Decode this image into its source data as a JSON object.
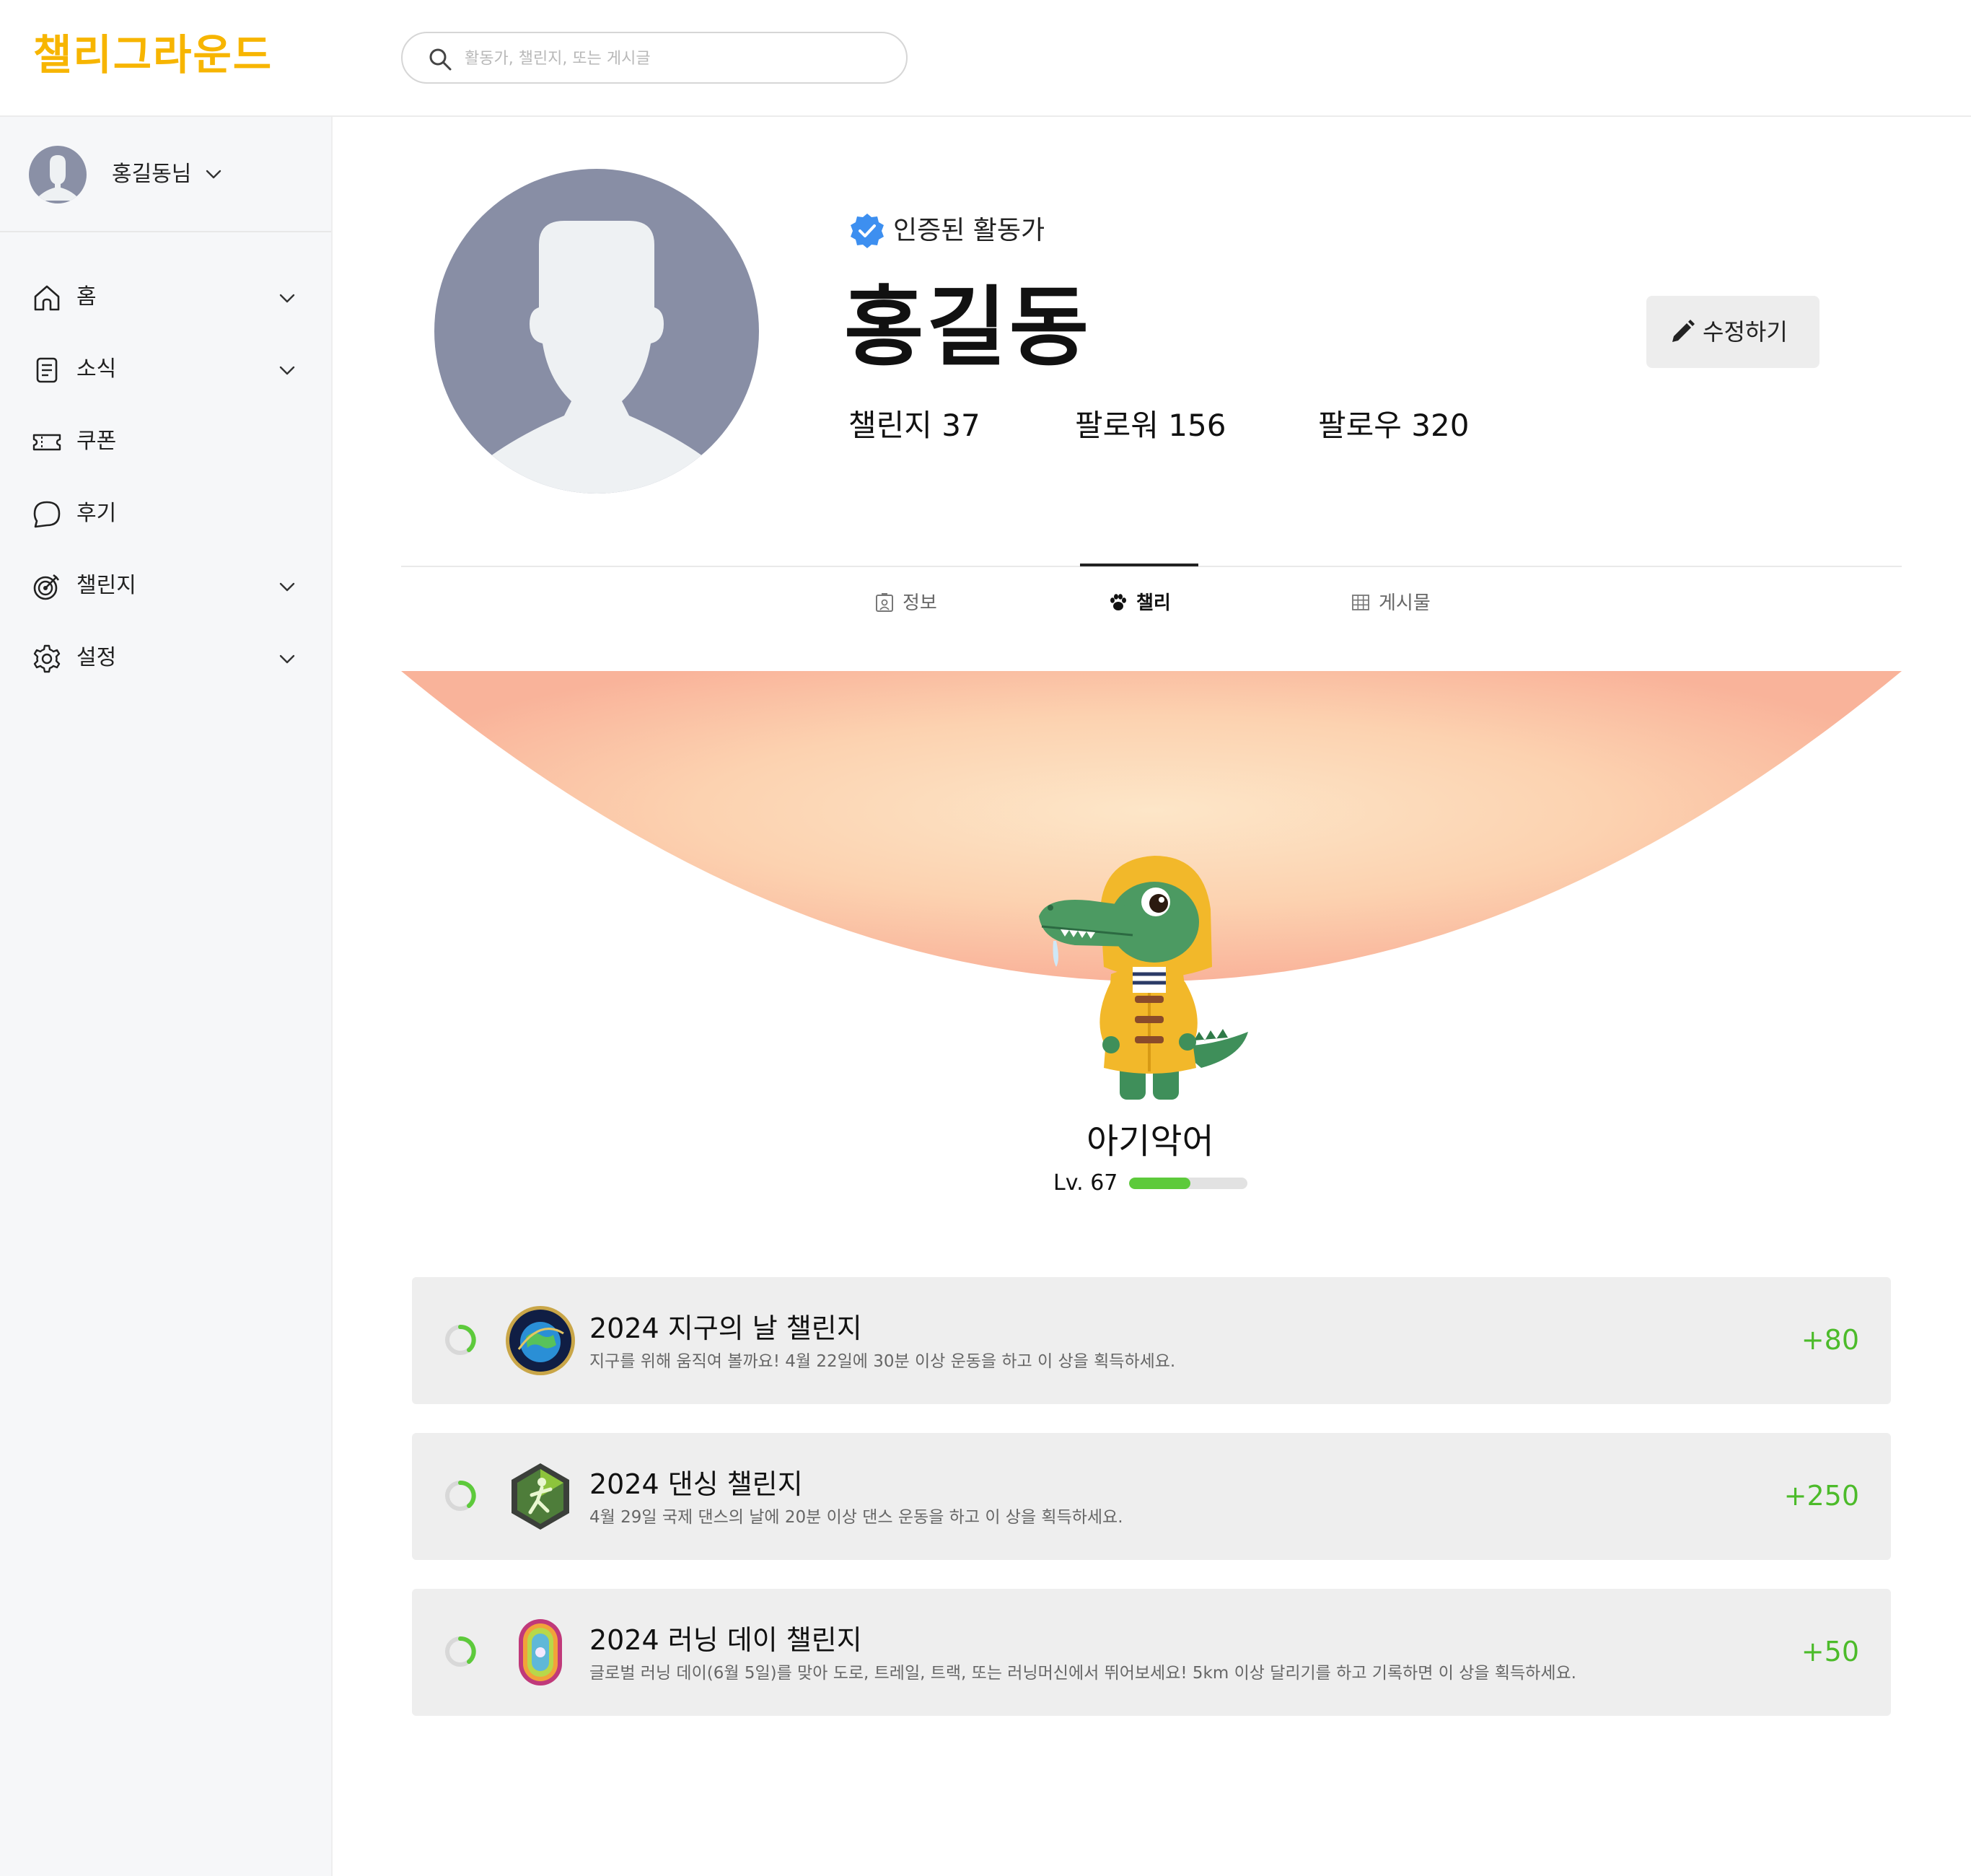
{
  "app": {
    "logo": "챌리그라운드"
  },
  "search": {
    "placeholder": "활동가, 챌린지, 또는 게시글"
  },
  "sidebar": {
    "user_name": "홍길동님",
    "items": [
      {
        "label": "홈",
        "icon": "home-icon",
        "has_caret": true
      },
      {
        "label": "소식",
        "icon": "document-icon",
        "has_caret": true
      },
      {
        "label": "쿠폰",
        "icon": "ticket-icon",
        "has_caret": false
      },
      {
        "label": "후기",
        "icon": "chat-bubble-icon",
        "has_caret": false
      },
      {
        "label": "챌린지",
        "icon": "target-icon",
        "has_caret": true
      },
      {
        "label": "설정",
        "icon": "gear-icon",
        "has_caret": true
      }
    ]
  },
  "profile": {
    "verified_label": "인증된 활동가",
    "name": "홍길동",
    "edit_label": "수정하기",
    "stats": {
      "challenges": "챌린지 37",
      "followers": "팔로워 156",
      "following": "팔로우 320"
    }
  },
  "tabs": [
    {
      "label": "정보",
      "icon": "id-card-icon",
      "active": false
    },
    {
      "label": "챌리",
      "icon": "paw-icon",
      "active": true
    },
    {
      "label": "게시물",
      "icon": "grid-icon",
      "active": false
    }
  ],
  "character": {
    "name": "아기악어",
    "level_label": "Lv. 67",
    "level_progress": 0.52
  },
  "challenges": [
    {
      "title": "2024 지구의 날 챌린지",
      "description": "지구를 위해 움직여 볼까요! 4월 22일에 30분 이상 운동을 하고 이 상을 획득하세요.",
      "points": "+80",
      "badge": "earth-day-badge-icon"
    },
    {
      "title": "2024 댄싱 챌린지",
      "description": "4월 29일 국제 댄스의 날에 20분 이상 댄스 운동을 하고 이 상을 획득하세요.",
      "points": "+250",
      "badge": "dancing-badge-icon"
    },
    {
      "title": "2024 러닝 데이 챌린지",
      "description": "글로벌 러닝 데이(6월 5일)를 맞아 도로, 트레일, 트랙, 또는 러닝머신에서 뛰어보세요! 5km 이상 달리기를 하고 기록하면 이 상을 획득하세요.",
      "points": "+50",
      "badge": "running-day-badge-icon"
    }
  ],
  "colors": {
    "brand": "#f7b500",
    "progress": "#5dca3b",
    "points": "#4cbb2a",
    "verified": "#3d8ff0",
    "arc_edge": "#f9b39a",
    "arc_center": "#fde3c4"
  }
}
